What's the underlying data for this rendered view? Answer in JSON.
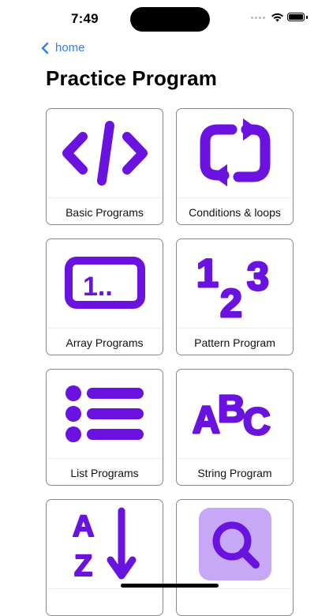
{
  "status_bar": {
    "time": "7:49"
  },
  "nav": {
    "back_label": "home",
    "accent_color": "#2f7ff0"
  },
  "page": {
    "title": "Practice Program"
  },
  "icon_color": "#6a12e0",
  "cards": [
    {
      "label": "Basic Programs",
      "icon": "code-brackets-icon"
    },
    {
      "label": "Conditions & loops",
      "icon": "loop-arrows-icon"
    },
    {
      "label": "Array Programs",
      "icon": "array-box-icon",
      "icon_text": "1.."
    },
    {
      "label": "Pattern Program",
      "icon": "numbers-123-icon",
      "icon_text": [
        "1",
        "2",
        "3"
      ]
    },
    {
      "label": "List Programs",
      "icon": "bullet-list-icon"
    },
    {
      "label": "String Program",
      "icon": "abc-letters-icon",
      "icon_text": [
        "A",
        "B",
        "C"
      ]
    },
    {
      "label": "",
      "icon": "sort-a-z-icon",
      "icon_text": [
        "A",
        "Z"
      ]
    },
    {
      "label": "",
      "icon": "search-icon"
    }
  ]
}
